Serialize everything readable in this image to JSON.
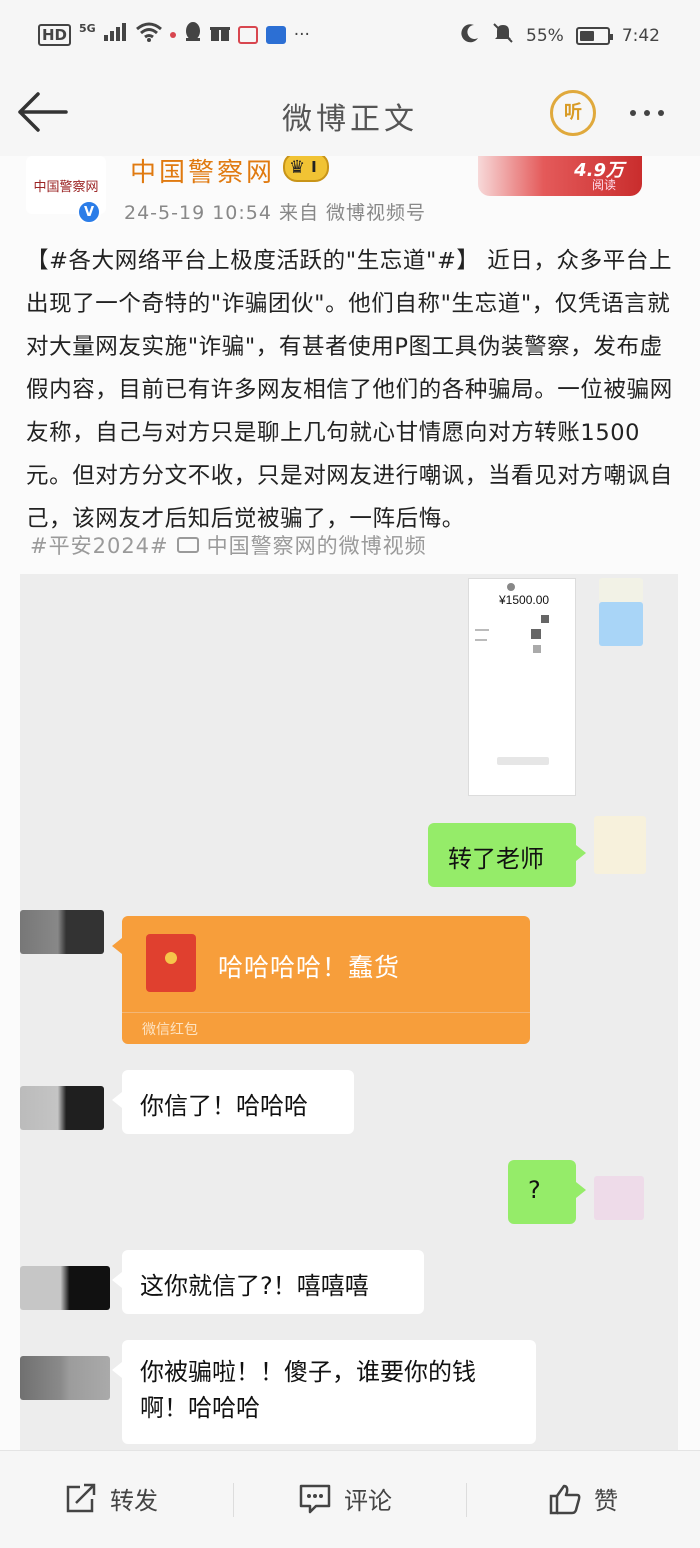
{
  "status_bar": {
    "network": "HD",
    "signal": "5G",
    "battery": "55%",
    "time": "7:42"
  },
  "nav": {
    "title": "微博正文",
    "listen_label": "听"
  },
  "post": {
    "avatar_text": "中国警察网",
    "author": "中国警察网",
    "vip_level": "I",
    "meta": "24-5-19 10:54  来自 微博视频号",
    "read_count": "4.9万",
    "read_label": "阅读",
    "body": "【#各大网络平台上极度活跃的\"生忘道\"#】 近日，众多平台上出现了一个奇特的\"诈骗团伙\"。他们自称\"生忘道\"，仅凭语言就对大量网友实施\"诈骗\"，有甚者使用P图工具伪装警察，发布虚假内容，目前已有许多网友相信了他们的各种骗局。一位被骗网友称，自己与对方只是聊上几句就心甘情愿向对方转账1500元。但对方分文不收，只是对网友进行嘲讽，当看见对方嘲讽自己，该网友才后知后觉被骗了，一阵后悔。",
    "tag1": "#平安2024#",
    "tag2": "中国警察网的微博视频"
  },
  "chat": {
    "payment_amount": "¥1500.00",
    "messages": [
      {
        "side": "right",
        "text": "转了老师"
      },
      {
        "side": "left",
        "text": "哈哈哈哈！蠢货",
        "kind": "red-packet",
        "footer": "微信红包"
      },
      {
        "side": "left",
        "text": "你信了！哈哈哈"
      },
      {
        "side": "right",
        "text": "?"
      },
      {
        "side": "left",
        "text": "这你就信了?！嘻嘻嘻"
      },
      {
        "side": "left",
        "text": "你被骗啦！！傻子，谁要你的钱啊！哈哈哈"
      }
    ]
  },
  "actions": {
    "repost": "转发",
    "comment": "评论",
    "like": "赞"
  },
  "colors": {
    "author": "#e07a10",
    "wechat_green": "#95ec69",
    "red_packet": "#f79e3b"
  }
}
